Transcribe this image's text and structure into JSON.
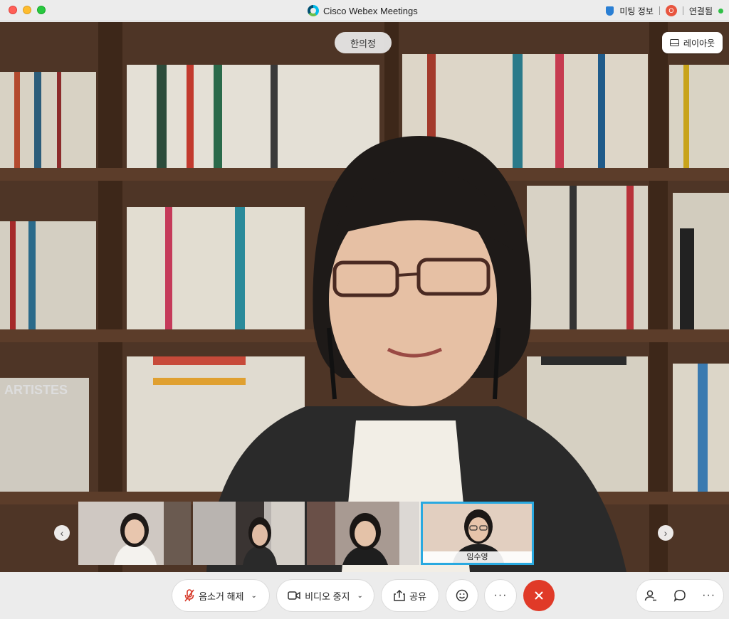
{
  "window": {
    "title": "Cisco Webex Meetings",
    "meeting_info_label": "미팅 정보",
    "record_badge": "O",
    "connection_status": "연결됨"
  },
  "video": {
    "active_speaker": "한의정",
    "layout_label": "레이아웃",
    "background_text": "ARTISTES"
  },
  "thumbnails": [
    {
      "name": ""
    },
    {
      "name": ""
    },
    {
      "name": ""
    },
    {
      "name": "임수영",
      "active": true
    }
  ],
  "toolbar": {
    "unmute_label": "음소거 해제",
    "stop_video_label": "비디오 중지",
    "share_label": "공유",
    "more_label": "···"
  },
  "colors": {
    "end_call": "#e03a28",
    "active_thumb_border": "#29a9e0",
    "connected_dot": "#2fbf46"
  }
}
